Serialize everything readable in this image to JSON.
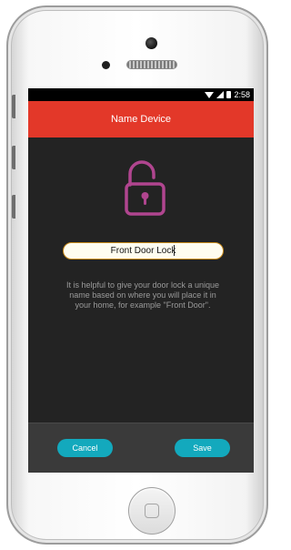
{
  "status_bar": {
    "time": "2:58",
    "icons": [
      "wifi-icon",
      "signal-icon",
      "battery-icon"
    ]
  },
  "header": {
    "title": "Name Device"
  },
  "lock": {
    "icon": "unlocked-padlock-icon",
    "color": "#b0458f"
  },
  "name_field": {
    "value": "Front Door Lock"
  },
  "helper_text": "It is helpful to give your door lock a unique name based on where you will place it in your home, for example \"Front Door\".",
  "actions": {
    "cancel_label": "Cancel",
    "save_label": "Save"
  },
  "colors": {
    "accent": "#e33829",
    "button": "#13a9bd",
    "background": "#232323"
  }
}
